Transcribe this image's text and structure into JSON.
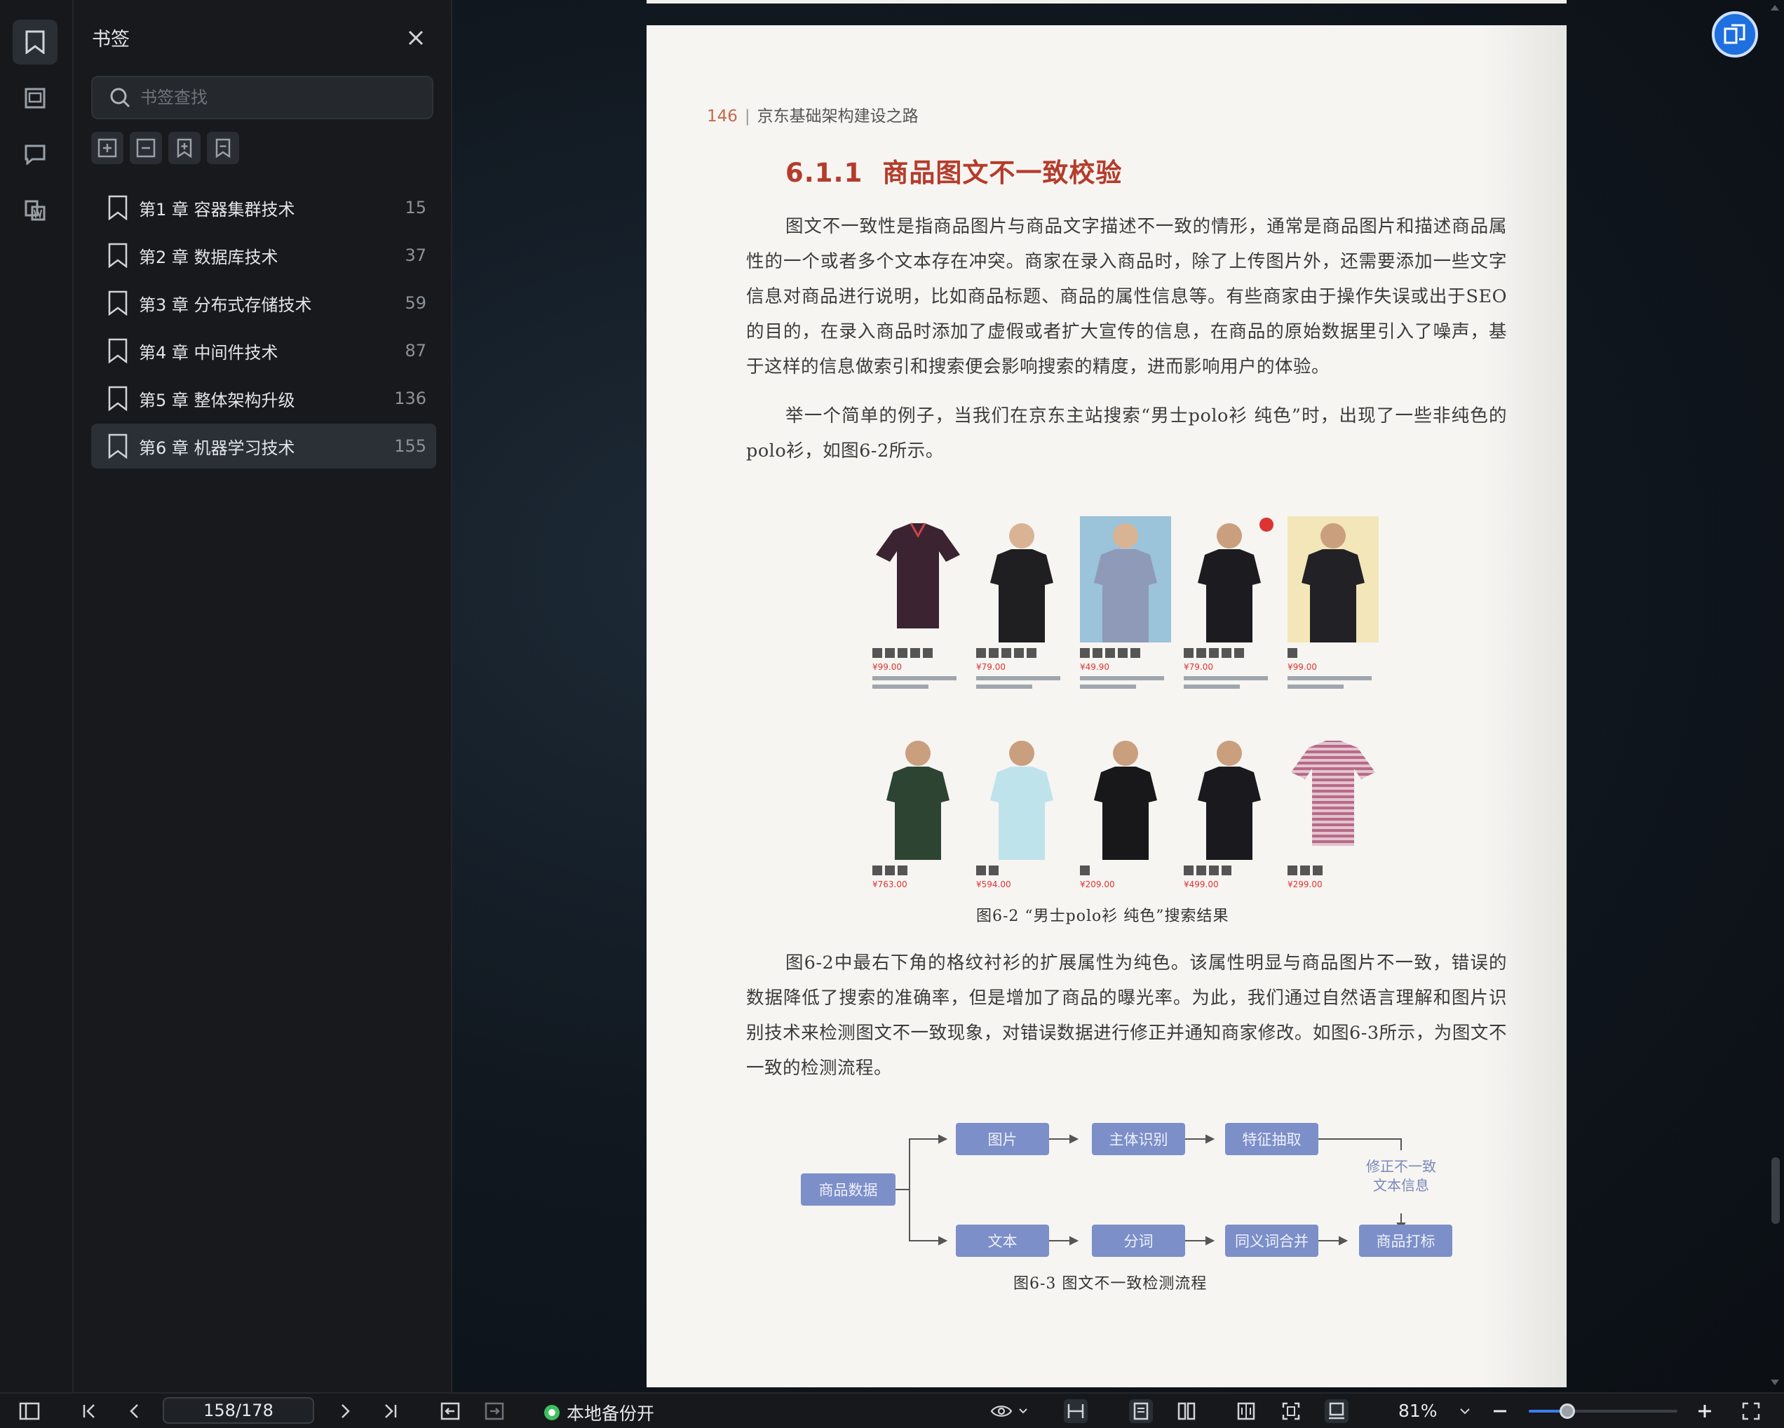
{
  "sidebar": {
    "title": "书签",
    "search_placeholder": "书签查找",
    "bookmarks": [
      {
        "label": "第1 章  容器集群技术",
        "page": "15"
      },
      {
        "label": "第2 章  数据库技术",
        "page": "37"
      },
      {
        "label": "第3 章  分布式存储技术",
        "page": "59"
      },
      {
        "label": "第4 章  中间件技术",
        "page": "87"
      },
      {
        "label": "第5 章  整体架构升级",
        "page": "136"
      },
      {
        "label": "第6 章  机器学习技术",
        "page": "155"
      }
    ],
    "active_index": 5
  },
  "document": {
    "page_number": "146",
    "running_head": "京东基础架构建设之路",
    "section_number": "6.1.1",
    "section_title": "商品图文不一致校验",
    "para1": "图文不一致性是指商品图片与商品文字描述不一致的情形，通常是商品图片和描述商品属性的一个或者多个文本存在冲突。商家在录入商品时，除了上传图片外，还需要添加一些文字信息对商品进行说明，比如商品标题、商品的属性信息等。有些商家由于操作失误或出于SEO的目的，在录入商品时添加了虚假或者扩大宣传的信息，在商品的原始数据里引入了噪声，基于这样的信息做索引和搜索便会影响搜索的精度，进而影响用户的体验。",
    "para2": "举一个简单的例子，当我们在京东主站搜索“男士polo衫 纯色”时，出现了一些非纯色的polo衫，如图6-2所示。",
    "figure2": {
      "caption": "图6-2  “男士polo衫 纯色”搜索结果",
      "prices_row1": [
        "¥99.00",
        "¥79.00",
        "¥49.90",
        "¥79.00",
        "¥99.00"
      ],
      "prices_row2": [
        "¥763.00",
        "¥594.00",
        "¥209.00",
        "¥499.00",
        "¥299.00"
      ]
    },
    "para3": "图6-2中最右下角的格纹衬衫的扩展属性为纯色。该属性明显与商品图片不一致，错误的数据降低了搜索的准确率，但是增加了商品的曝光率。为此，我们通过自然语言理解和图片识别技术来检测图文不一致现象，对错误数据进行修正并通知商家修改。如图6-3所示，为图文不一致的检测流程。",
    "figure3": {
      "caption": "图6-3  图文不一致检测流程",
      "source": "商品数据",
      "image_branch": [
        "图片",
        "主体识别",
        "特征抽取"
      ],
      "text_branch": [
        "文本",
        "分词",
        "同义词合并",
        "商品打标"
      ],
      "note_line1": "修正不一致",
      "note_line2": "文本信息"
    }
  },
  "toolbar": {
    "page_indicator": "158/178",
    "backup_status": "本地备份开",
    "zoom": "81%",
    "zoom_fraction": 0.26
  },
  "colors": {
    "accent": "#3c7df0",
    "section_title": "#b53b2b",
    "flow_box": "#7d8fc8",
    "backup_dot": "#3fbf5f"
  }
}
